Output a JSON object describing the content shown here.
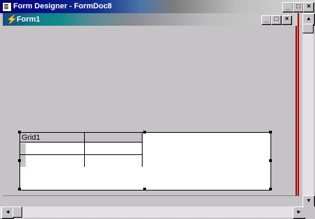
{
  "app": {
    "title": "Form Designer - FormDoc8",
    "icon": "form-designer-icon"
  },
  "form": {
    "title": "Form1",
    "icon": "lightning-form-icon"
  },
  "grid": {
    "caption": "Grid1"
  },
  "caption_buttons": {
    "minimize": "_",
    "maximize": "□",
    "close": "×"
  },
  "scroll": {
    "up": "▲",
    "down": "▼",
    "left": "◄",
    "right": "►"
  },
  "colors": {
    "title_active": "#000080",
    "form_title": "#108c8c",
    "surface": "#c6c3c6"
  }
}
